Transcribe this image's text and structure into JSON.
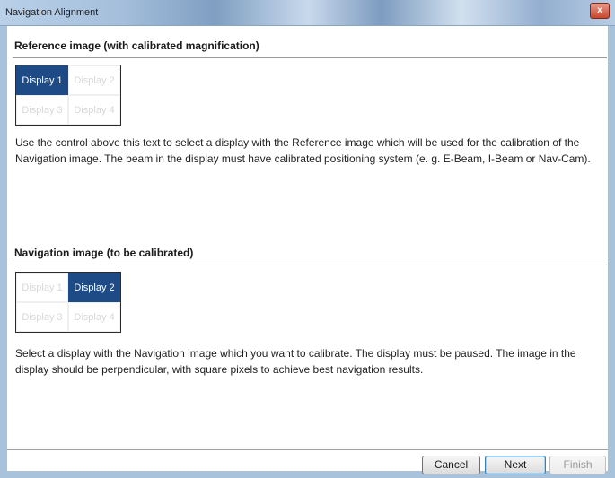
{
  "window": {
    "title": "Navigation Alignment",
    "close_label": "x"
  },
  "reference": {
    "title": "Reference image (with calibrated magnification)",
    "displays": [
      "Display 1",
      "Display 2",
      "Display 3",
      "Display 4"
    ],
    "selected": "Display 1",
    "description": "Use the control above this text to select a display with the Reference image which will be used for the calibration of the Navigation image. The beam in the display must have calibrated positioning system (e. g. E-Beam, I-Beam or Nav-Cam)."
  },
  "navigation": {
    "title": "Navigation image (to be calibrated)",
    "displays": [
      "Display 1",
      "Display 2",
      "Display 3",
      "Display 4"
    ],
    "selected": "Display 2",
    "description": "Select a display with the Navigation image which you want to calibrate. The display must be paused. The image in the display should be perpendicular, with square pixels to achieve best navigation results."
  },
  "buttons": {
    "cancel": "Cancel",
    "next": "Next",
    "finish": "Finish"
  },
  "colors": {
    "selected_display": "#1e4b86",
    "unselected_text": "#d8d8d8"
  }
}
